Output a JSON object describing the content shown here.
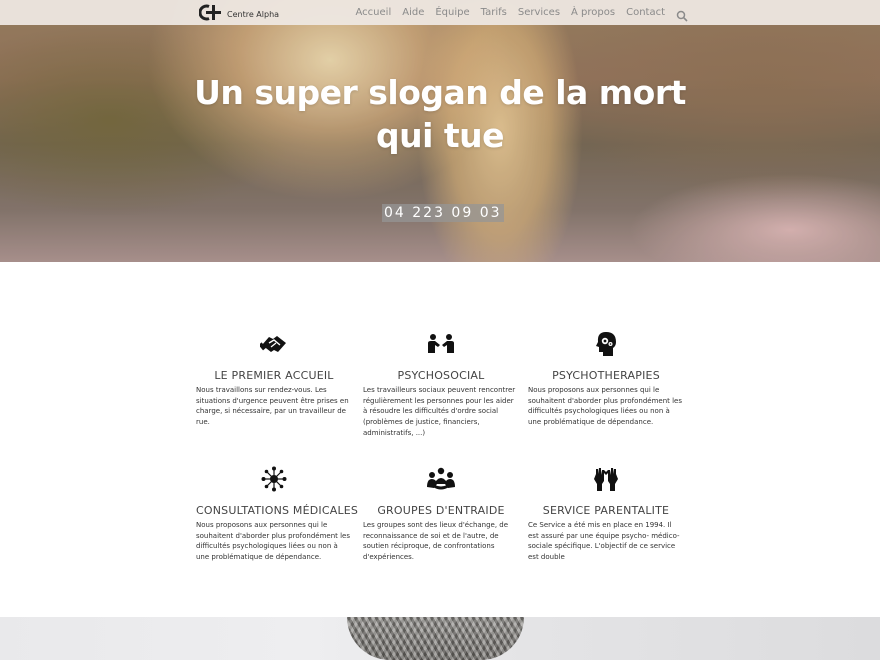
{
  "brand": {
    "name": "Centre Alpha",
    "logo_icon": "logo-c-mark"
  },
  "nav": {
    "links": [
      "Accueil",
      "Aide",
      "Équipe",
      "Tarifs",
      "Services",
      "À propos",
      "Contact"
    ],
    "search_icon": "search-icon"
  },
  "hero": {
    "title": "Un super slogan de la mort qui tue",
    "phone": "04 223 09 03"
  },
  "services": [
    {
      "icon": "handshake-icon",
      "title": "LE PREMIER ACCUEIL",
      "text": "Nous travaillons sur rendez-vous. Les situations d'urgence peuvent être prises en charge, si nécessaire, par un travailleur de rue."
    },
    {
      "icon": "meeting-people-icon",
      "title": "PSYCHOSOCIAL",
      "text": "Les travailleurs sociaux peuvent rencontrer régulièrement les personnes pour les aider à résoudre les difficultés d'ordre social (problèmes de justice, financiers, administratifs, ...)"
    },
    {
      "icon": "head-gears-icon",
      "title": "PSYCHOTHERAPIES",
      "text": "Nous proposons aux personnes qui le souhaitent d'aborder plus profondément les difficultés psychologiques liées ou non à une problématique de dépendance."
    },
    {
      "icon": "network-icon",
      "title": "CONSULTATIONS MÉDICALES",
      "text": "Nous proposons aux personnes qui le souhaitent d'aborder plus profondément les difficultés psychologiques liées ou non à une problématique de dépendance."
    },
    {
      "icon": "group-icon",
      "title": "GROUPES D'ENTRAIDE",
      "text": "Les groupes sont des lieux d'échange, de reconnaissance de soi et de l'autre, de soutien réciproque, de confrontations d'expériences."
    },
    {
      "icon": "raised-hands-icon",
      "title": "SERVICE PARENTALITE",
      "text": "Ce Service a été mis en place en 1994. Il est assuré par une équipe psycho- médico-sociale spécifique. L'objectif de ce service est double"
    }
  ]
}
